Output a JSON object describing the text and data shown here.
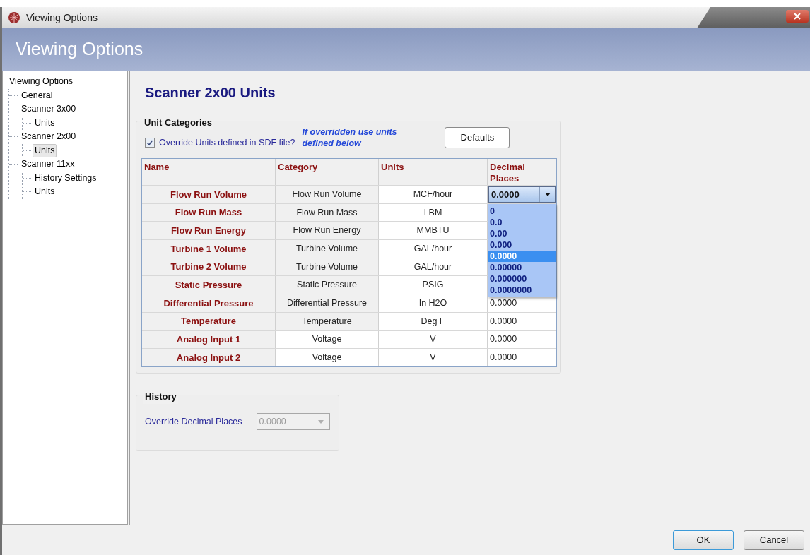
{
  "window": {
    "title": "Viewing Options"
  },
  "header": {
    "title": "Viewing Options"
  },
  "tree": [
    {
      "label": "Viewing Options",
      "selected": false,
      "children": [
        {
          "label": "General",
          "selected": false
        },
        {
          "label": "Scanner 3x00",
          "selected": false,
          "children": [
            {
              "label": "Units",
              "selected": false
            }
          ]
        },
        {
          "label": "Scanner 2x00",
          "selected": false,
          "children": [
            {
              "label": "Units",
              "selected": true
            }
          ]
        },
        {
          "label": "Scanner 11xx",
          "selected": false,
          "children": [
            {
              "label": "History Settings",
              "selected": false
            },
            {
              "label": "Units",
              "selected": false
            }
          ]
        }
      ]
    }
  ],
  "page_title": "Scanner 2x00 Units",
  "unit_categories": {
    "title": "Unit Categories",
    "override": {
      "label": "Override Units defined in SDF file?",
      "checked": true
    },
    "note": "If overridden use units defined below",
    "defaults_button": "Defaults",
    "columns": [
      "Name",
      "Category",
      "Units",
      "Decimal Places"
    ],
    "rows": [
      {
        "name": "Flow Run Volume",
        "category": "Flow Run Volume",
        "units": "MCF/hour",
        "editable": false,
        "decimal": "0.0000",
        "kind": "combo"
      },
      {
        "name": "Flow Run Mass",
        "category": "Flow Run Mass",
        "units": "LBM",
        "editable": false,
        "kind": "hidden"
      },
      {
        "name": "Flow Run Energy",
        "category": "Flow Run Energy",
        "units": "MMBTU",
        "editable": false,
        "kind": "hidden"
      },
      {
        "name": "Turbine 1 Volume",
        "category": "Turbine Volume",
        "units": "GAL/hour",
        "editable": false,
        "kind": "hidden"
      },
      {
        "name": "Turbine 2 Volume",
        "category": "Turbine Volume",
        "units": "GAL/hour",
        "editable": false,
        "kind": "hidden"
      },
      {
        "name": "Static Pressure",
        "category": "Static Pressure",
        "units": "PSIG",
        "editable": false,
        "kind": "hidden"
      },
      {
        "name": "Differential Pressure",
        "category": "Differential Pressure",
        "units": "In H2O",
        "editable": false,
        "decimal": "0.0000",
        "kind": "text"
      },
      {
        "name": "Temperature",
        "category": "Temperature",
        "units": "Deg F",
        "editable": false,
        "decimal": "0.0000",
        "kind": "text"
      },
      {
        "name": "Analog Input 1",
        "category": "Voltage",
        "units": "V",
        "editable": true,
        "decimal": "0.0000",
        "kind": "text"
      },
      {
        "name": "Analog Input 2",
        "category": "Voltage",
        "units": "V",
        "editable": true,
        "decimal": "0.0000",
        "kind": "text"
      }
    ],
    "dropdown_options": [
      {
        "label": "0",
        "selected": false
      },
      {
        "label": "0.0",
        "selected": false
      },
      {
        "label": "0.00",
        "selected": false
      },
      {
        "label": "0.000",
        "selected": false
      },
      {
        "label": "0.0000",
        "selected": true
      },
      {
        "label": "0.00000",
        "selected": false
      },
      {
        "label": "0.000000",
        "selected": false
      },
      {
        "label": "0.0000000",
        "selected": false
      }
    ]
  },
  "history": {
    "title": "History",
    "label": "Override Decimal Places",
    "value": "0.0000",
    "disabled": true
  },
  "buttons": [
    "OK",
    "Cancel"
  ]
}
